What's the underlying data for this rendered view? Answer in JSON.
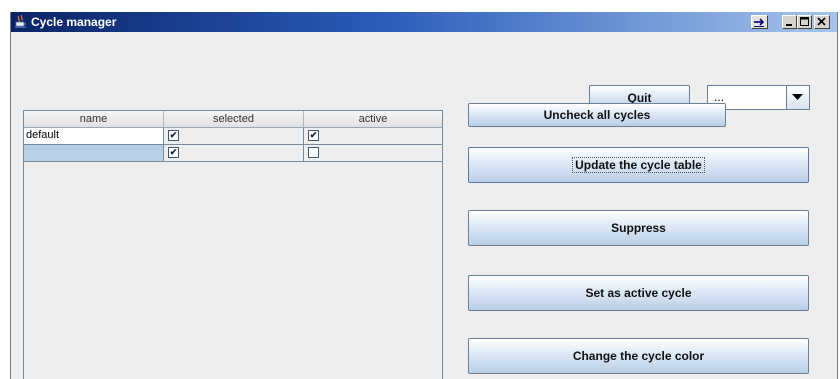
{
  "window": {
    "title": "Cycle manager"
  },
  "controls": {
    "quit_label": "Quit",
    "combo_value": "...",
    "uncheck_all_label": "Uncheck all cycles",
    "update_label": "Update the cycle table",
    "suppress_label": "Suppress",
    "set_active_label": "Set as active cycle",
    "change_color_label": "Change the cycle color"
  },
  "table": {
    "headers": [
      "name",
      "selected",
      "active"
    ],
    "rows": [
      {
        "name": "default",
        "selected": true,
        "active": true
      },
      {
        "name": "",
        "selected": true,
        "active": false
      }
    ]
  },
  "colors": {
    "title_gradient_start": "#0b2466",
    "title_gradient_end": "#a6c4ec",
    "selected_row": "#b8cfe5",
    "window_bg": "#eeeeee"
  },
  "icons": [
    "java-cup-icon",
    "pin-arrow-icon",
    "minimize-icon",
    "maximize-icon",
    "close-icon",
    "dropdown-arrow-icon",
    "checkmark-icon"
  ]
}
